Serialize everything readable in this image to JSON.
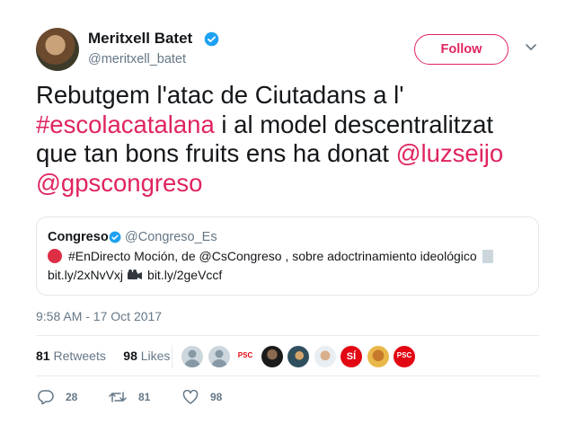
{
  "header": {
    "display_name": "Meritxell Batet",
    "handle": "@meritxell_batet",
    "follow_label": "Follow"
  },
  "tweet": {
    "segments": [
      {
        "text": "Rebutgem l'atac de Ciutadans a l' ",
        "tag": false
      },
      {
        "text": "#escolacatalana",
        "tag": true
      },
      {
        "text": " i al model descentralitzat que tan bons fruits ens ha donat ",
        "tag": false
      },
      {
        "text": "@luzseijo",
        "tag": true
      },
      {
        "text": " ",
        "tag": false
      },
      {
        "text": "@gpscongreso",
        "tag": true
      }
    ]
  },
  "quote": {
    "name": "Congreso",
    "handle": "@Congreso_Es",
    "line1": "#EnDirecto Moción, de @CsCongreso , sobre adoctrinamiento ideológico",
    "line2a": "bit.ly/2xNvVxj",
    "line2b": "bit.ly/2geVccf"
  },
  "timestamp": "9:58 AM - 17 Oct 2017",
  "stats": {
    "retweets_count": "81",
    "retweets_label": "Retweets",
    "likes_count": "98",
    "likes_label": "Likes"
  },
  "likers": [
    {
      "kind": "default",
      "label": ""
    },
    {
      "kind": "default",
      "label": ""
    },
    {
      "kind": "psc-square",
      "label": "PSC"
    },
    {
      "kind": "photo-dark",
      "label": ""
    },
    {
      "kind": "photo-teal",
      "label": ""
    },
    {
      "kind": "photo-light",
      "label": ""
    },
    {
      "kind": "si-logo",
      "label": "SÍ"
    },
    {
      "kind": "photo-gold",
      "label": ""
    },
    {
      "kind": "psc-round",
      "label": "PSC"
    }
  ],
  "actions": {
    "reply_count": "28",
    "retweet_count": "81",
    "like_count": "98"
  },
  "colors": {
    "accent": "#e0245e",
    "verified": "#1da1f2",
    "muted": "#657786",
    "text": "#14171a"
  },
  "icons": [
    "verified-icon",
    "chevron-down-icon",
    "red-circle-icon",
    "document-icon",
    "camera-icon",
    "reply-icon",
    "retweet-icon",
    "heart-icon"
  ]
}
